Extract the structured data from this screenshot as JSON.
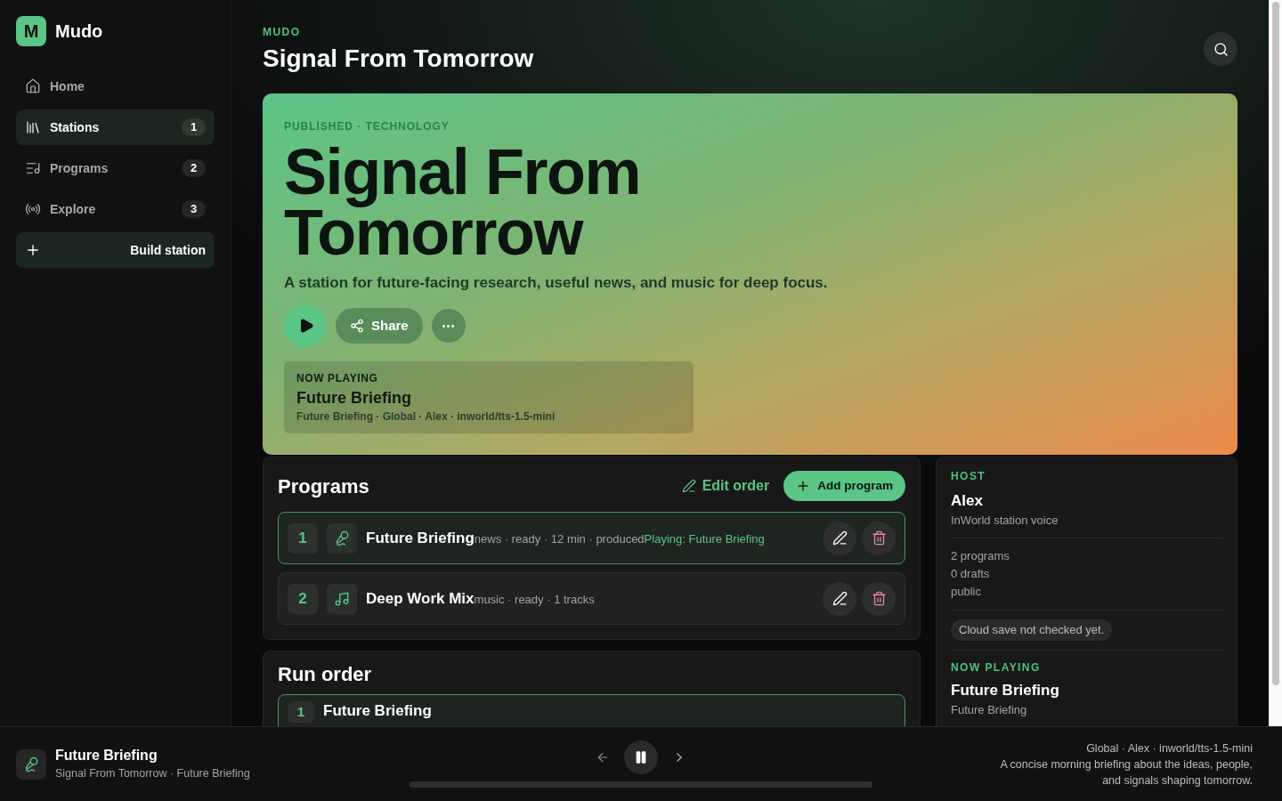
{
  "sidebar": {
    "logo": {
      "mark": "M",
      "name": "Mudo"
    },
    "nav": [
      {
        "label": "Home",
        "selected": false
      },
      {
        "label": "Stations",
        "count": "1",
        "selected": true
      },
      {
        "label": "Programs",
        "count": "2",
        "selected": false
      },
      {
        "label": "Explore",
        "count": "3",
        "selected": false
      }
    ],
    "build_button": "Build station"
  },
  "header": {
    "eyebrow": "MUDO",
    "title": "Signal From Tomorrow"
  },
  "hero": {
    "tagline": "PUBLISHED · TECHNOLOGY",
    "title": "Signal From Tomorrow",
    "description": "A station for future-facing research, useful news, and music for deep focus.",
    "share_button": "Share",
    "now_playing": {
      "label": "NOW PLAYING",
      "title": "Future Briefing",
      "meta": "Future Briefing · Global · Alex · inworld/tts-1.5-mini"
    }
  },
  "programs": {
    "title": "Programs",
    "edit_order": "Edit order",
    "add_button": "Add program",
    "rows": [
      {
        "number": "1",
        "kind": "news",
        "title": "Future Briefing",
        "meta": "news · ready · 12 min · produced",
        "playing_label": "Playing: Future Briefing",
        "selected": true
      },
      {
        "number": "2",
        "kind": "music",
        "title": "Deep Work Mix",
        "meta": "music · ready · 1 tracks",
        "selected": false
      }
    ]
  },
  "run_order": {
    "title": "Run order",
    "items": [
      {
        "number": "1",
        "title": "Future Briefing",
        "selected": true
      }
    ]
  },
  "host_panel": {
    "label": "HOST",
    "name": "Alex",
    "voice": "InWorld station voice",
    "stats": [
      "2 programs",
      "0 drafts",
      "public"
    ],
    "cloud_status": "Cloud save not checked yet.",
    "now_playing_label": "NOW PLAYING",
    "now_playing_title": "Future Briefing",
    "now_playing_subtitle": "Future Briefing"
  },
  "player": {
    "kind": "news",
    "title": "Future Briefing",
    "subtitle": "Signal From Tomorrow · Future Briefing",
    "playing": true,
    "meta": "Global · Alex · inworld/tts-1.5-mini",
    "description": "A concise morning briefing about the ideas, people, and signals shaping tomorrow."
  }
}
